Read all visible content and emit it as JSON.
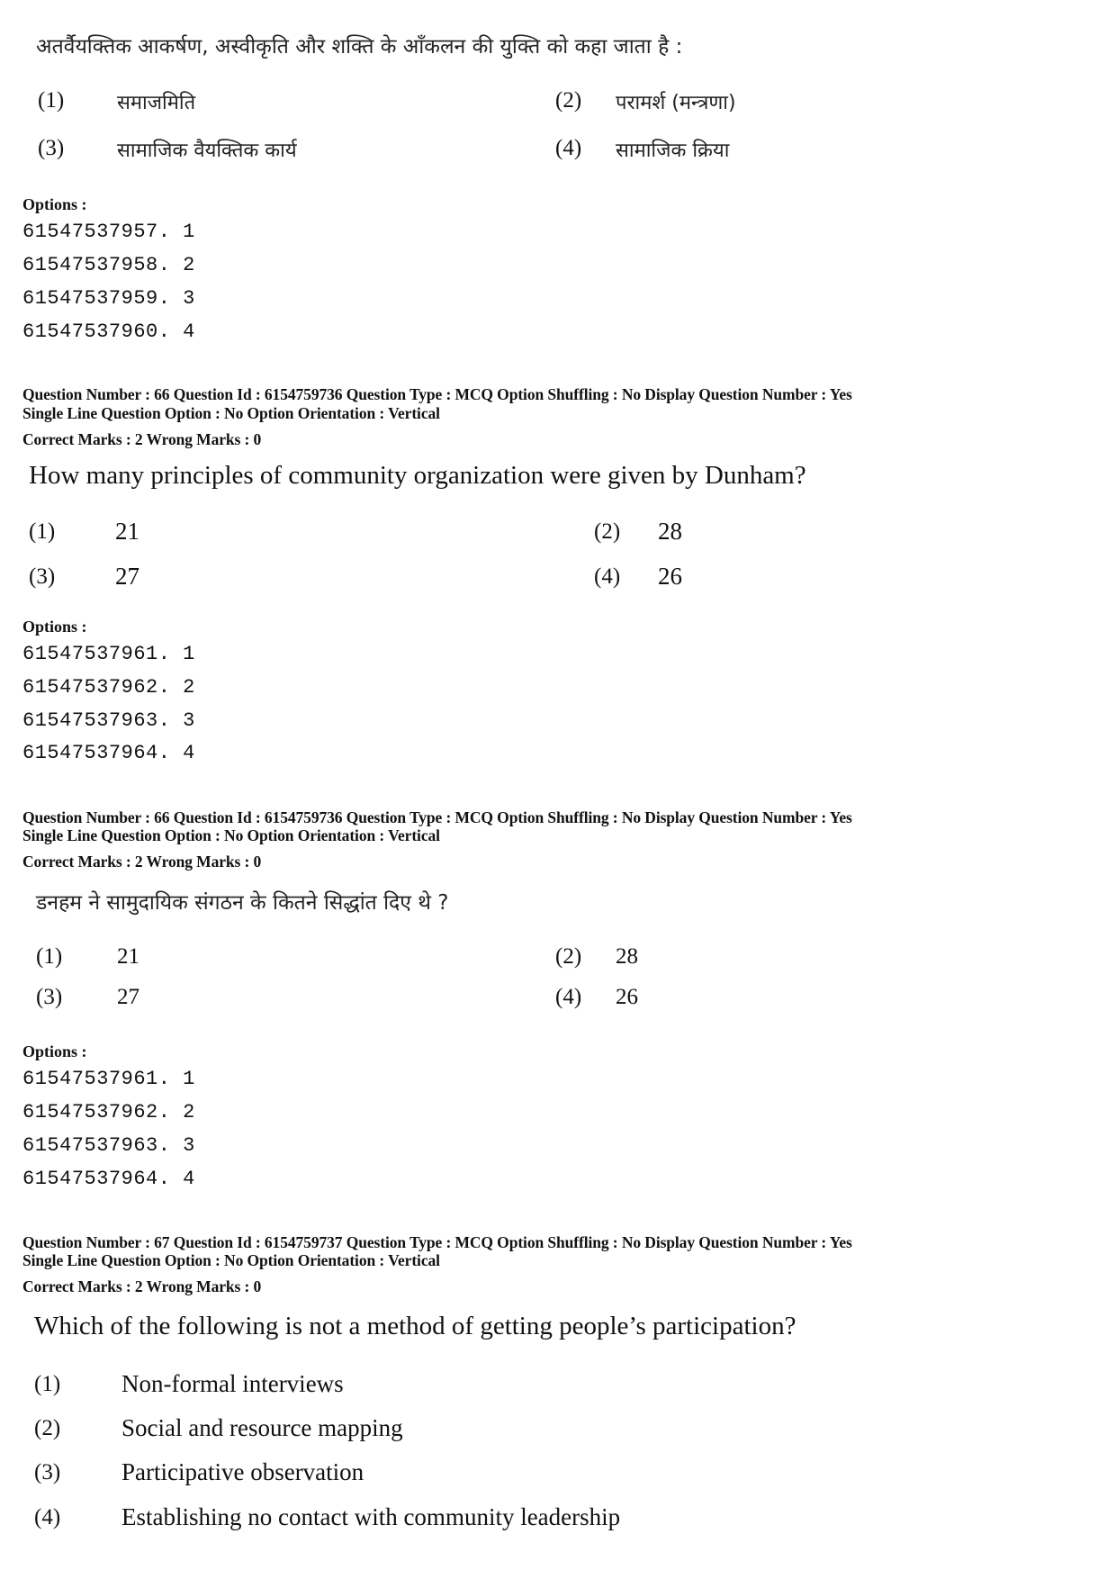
{
  "blocks": [
    {
      "question_text": "अतर्वैयक्तिक आकर्षण, अस्वीकृति और शक्ति के आँकलन की युक्ति को कहा जाता है :",
      "choices": [
        {
          "num": "(1)",
          "text": "समाजमिति"
        },
        {
          "num": "(2)",
          "text": "परामर्श (मन्त्रणा)"
        },
        {
          "num": "(3)",
          "text": "सामाजिक वैयक्तिक कार्य"
        },
        {
          "num": "(4)",
          "text": "सामाजिक क्रिया"
        }
      ],
      "options_label": "Options :",
      "option_ids": [
        "61547537957. 1",
        "61547537958. 2",
        "61547537959. 3",
        "61547537960. 4"
      ]
    },
    {
      "meta_line1": "Question Number : 66  Question Id : 6154759736  Question Type : MCQ  Option Shuffling : No  Display Question Number : Yes",
      "meta_line2": "Single Line Question Option : No  Option Orientation : Vertical",
      "marks_line": "Correct Marks : 2  Wrong Marks : 0",
      "question_text": "How many principles of community organization were given by Dunham?",
      "choices": [
        {
          "num": "(1)",
          "text": "21"
        },
        {
          "num": "(2)",
          "text": "28"
        },
        {
          "num": "(3)",
          "text": "27"
        },
        {
          "num": "(4)",
          "text": "26"
        }
      ],
      "options_label": "Options :",
      "option_ids": [
        "61547537961. 1",
        "61547537962. 2",
        "61547537963. 3",
        "61547537964. 4"
      ]
    },
    {
      "meta_line1": "Question Number : 66  Question Id : 6154759736  Question Type : MCQ  Option Shuffling : No  Display Question Number : Yes",
      "meta_line2": "Single Line Question Option : No  Option Orientation : Vertical",
      "marks_line": "Correct Marks : 2  Wrong Marks : 0",
      "question_text": "डनहम ने सामुदायिक संगठन के कितने सिद्धांत दिए थे ?",
      "choices": [
        {
          "num": "(1)",
          "text": "21"
        },
        {
          "num": "(2)",
          "text": "28"
        },
        {
          "num": "(3)",
          "text": "27"
        },
        {
          "num": "(4)",
          "text": "26"
        }
      ],
      "options_label": "Options :",
      "option_ids": [
        "61547537961. 1",
        "61547537962. 2",
        "61547537963. 3",
        "61547537964. 4"
      ]
    },
    {
      "meta_line1": "Question Number : 67  Question Id : 6154759737  Question Type : MCQ  Option Shuffling : No  Display Question Number : Yes",
      "meta_line2": "Single Line Question Option : No  Option Orientation : Vertical",
      "marks_line": "Correct Marks : 2  Wrong Marks : 0",
      "question_text": "Which of the following is not a method of getting people’s participation?",
      "choices": [
        {
          "num": "(1)",
          "text": "Non-formal interviews"
        },
        {
          "num": "(2)",
          "text": "Social and resource mapping"
        },
        {
          "num": "(3)",
          "text": "Participative observation"
        },
        {
          "num": "(4)",
          "text": "Establishing no contact with community leadership"
        }
      ]
    }
  ]
}
